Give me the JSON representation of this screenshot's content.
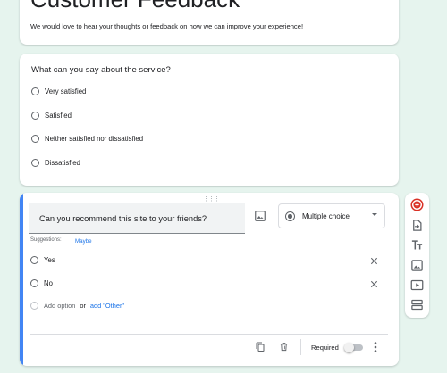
{
  "form": {
    "title": "Customer Feedback",
    "description": "We would love to hear your thoughts or feedback on how we can improve your experience!"
  },
  "question1": {
    "title": "What can you say about the service?",
    "options": [
      "Very satisfied",
      "Satisfied",
      "Neither satisfied nor dissatisfied",
      "Dissatisfied"
    ]
  },
  "question2": {
    "title": "Can you recommend this site to your friends?",
    "type": "Multiple choice",
    "suggestions_label": "Suggestions:",
    "suggestion": "Maybe",
    "options": [
      "Yes",
      "No"
    ],
    "add_option": "Add option",
    "or": "or",
    "add_other": "add \"Other\"",
    "required_label": "Required",
    "required": false
  },
  "colors": {
    "accent": "#4285f4",
    "link": "#1a73e8",
    "add_question": "#d93025",
    "background": "#e6f4ee"
  },
  "toolbar": {
    "icons": [
      "add-question-icon",
      "import-questions-icon",
      "add-title-icon",
      "add-image-icon",
      "add-video-icon",
      "add-section-icon"
    ]
  }
}
